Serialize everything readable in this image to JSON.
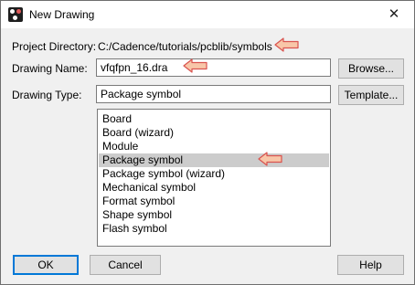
{
  "window": {
    "title": "New Drawing",
    "close_glyph": "✕"
  },
  "form": {
    "project_directory_label": "Project Directory:",
    "project_directory_value": "C:/Cadence/tutorials/pcblib/symbols",
    "drawing_name_label": "Drawing Name:",
    "drawing_name_value": "vfqfpn_16.dra",
    "drawing_type_label": "Drawing Type:",
    "drawing_type_value": "Package symbol"
  },
  "buttons": {
    "browse": "Browse...",
    "template": "Template...",
    "ok": "OK",
    "cancel": "Cancel",
    "help": "Help"
  },
  "drawing_types": [
    "Board",
    "Board (wizard)",
    "Module",
    "Package symbol",
    "Package symbol (wizard)",
    "Mechanical symbol",
    "Format symbol",
    "Shape symbol",
    "Flash symbol"
  ],
  "selected_type": "Package symbol",
  "colors": {
    "annotation_arrow_fill": "#f8c6a8",
    "annotation_arrow_stroke": "#d9534f",
    "selection": "#cccccc",
    "default_button_border": "#0078d7"
  }
}
